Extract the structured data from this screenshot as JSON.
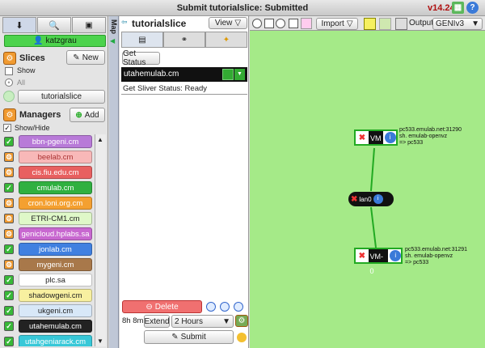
{
  "window": {
    "title": "Submit tutorialslice: Submitted",
    "version": "v14.24"
  },
  "user": {
    "name": "katzgrau"
  },
  "slices": {
    "title": "Slices",
    "new_label": "New",
    "show_label": "Show",
    "all_label": "All",
    "slice_button": "tutorialslice"
  },
  "managers": {
    "title": "Managers",
    "add_label": "Add",
    "showhide_label": "Show/Hide",
    "items": [
      {
        "label": "bbn-pgeni.cm",
        "color": "#b87ad8",
        "text": "#fff",
        "checked": true
      },
      {
        "label": "beelab.cm",
        "color": "#f8b8b8",
        "text": "#a33",
        "checked": false
      },
      {
        "label": "cis.fiu.edu.cm",
        "color": "#e86060",
        "text": "#fff",
        "checked": false
      },
      {
        "label": "cmulab.cm",
        "color": "#30b040",
        "text": "#fff",
        "checked": true
      },
      {
        "label": "cron.loni.org.cm",
        "color": "#f4a030",
        "text": "#fff",
        "checked": false
      },
      {
        "label": "ETRI-CM1.cm",
        "color": "#dff8c8",
        "text": "#222",
        "checked": false
      },
      {
        "label": "genicloud.hplabs.sa",
        "color": "#c868d0",
        "text": "#fff",
        "checked": false
      },
      {
        "label": "jonlab.cm",
        "color": "#4080e0",
        "text": "#fff",
        "checked": true
      },
      {
        "label": "mygeni.cm",
        "color": "#a8784a",
        "text": "#fff",
        "checked": false
      },
      {
        "label": "plc.sa",
        "color": "#ffffff",
        "text": "#222",
        "checked": true
      },
      {
        "label": "shadowgeni.cm",
        "color": "#f8f0a0",
        "text": "#222",
        "checked": true
      },
      {
        "label": "ukgeni.cm",
        "color": "#d8e8f8",
        "text": "#222",
        "checked": true
      },
      {
        "label": "utahemulab.cm",
        "color": "#222222",
        "text": "#fff",
        "checked": true
      },
      {
        "label": "utahgeniarack.cm",
        "color": "#38c8d8",
        "text": "#fff",
        "checked": true
      }
    ]
  },
  "map_tab": "Map",
  "slice_panel": {
    "name": "tutorialslice",
    "view_label": "View",
    "get_status": "Get Status",
    "cm_name": "utahemulab.cm",
    "sliver_status": "Get Sliver Status: Ready",
    "delete_label": "Delete",
    "time_left": "8h 8m",
    "extend_label": "Extend",
    "extend_value": "2 Hours",
    "submit_label": "Submit"
  },
  "toolbar": {
    "import_label": "Import",
    "output_label": "Output",
    "output_value": "GENIv3"
  },
  "nodes": [
    {
      "name": "VM",
      "info": "pc533.emulab.net:31290",
      "line2": "sh. emulab-openvz",
      "line3": "=> pc533"
    },
    {
      "name": "lan0"
    },
    {
      "name": "VM-0",
      "info": "pc533.emulab.net:31291",
      "line2": "sh. emulab-openvz",
      "line3": "=> pc533"
    }
  ]
}
